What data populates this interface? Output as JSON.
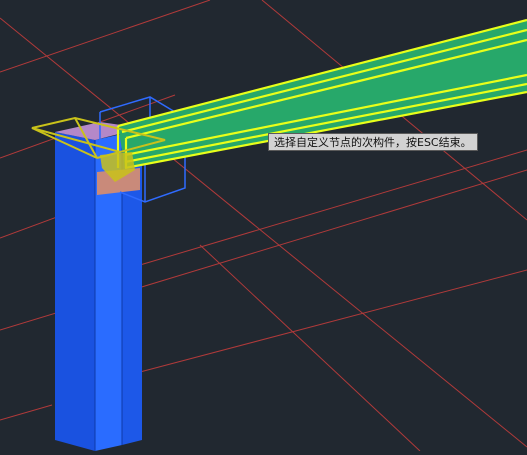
{
  "viewport": {
    "background": "#212830",
    "grid_color": "#b03a3a",
    "column_color": "#1f5ef0",
    "beam_color": "#27a86a",
    "highlight_color": "#e8ff1a",
    "bbox_color": "#2f6bff"
  },
  "tooltip": {
    "text": "选择自定义节点的次构件，按ESC结束。"
  }
}
